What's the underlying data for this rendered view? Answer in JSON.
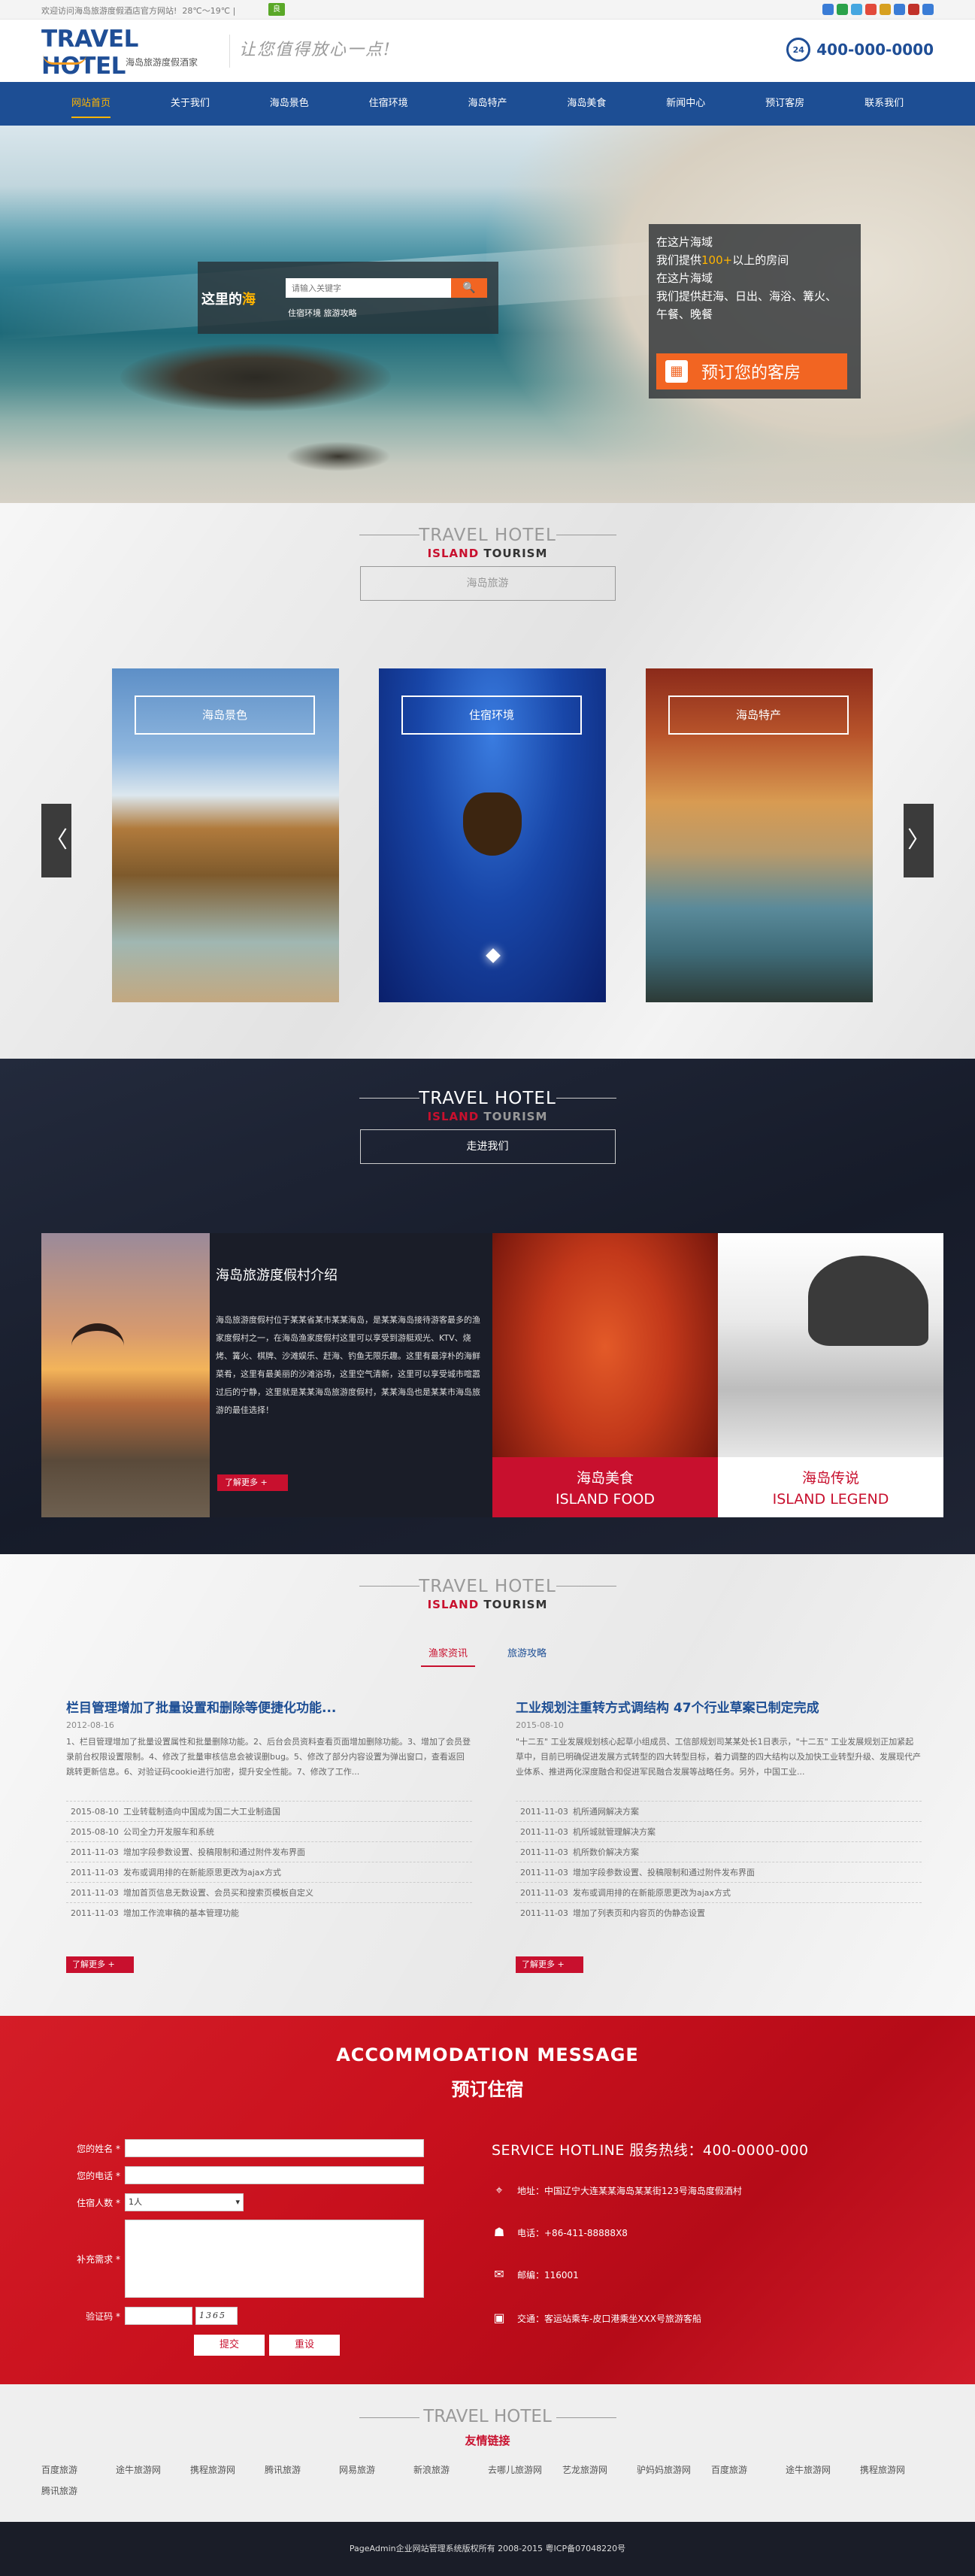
{
  "topbar": {
    "welcome": "欢迎访问海岛旅游度假酒店官方网站!",
    "weather": "28℃～19℃",
    "weather_badge": "良",
    "share_colors": [
      "#3a7cd6",
      "#2ba24a",
      "#45a6e0",
      "#e24a3b",
      "#d7a020",
      "#3a7cd6",
      "#c1322a",
      "#3a7cd6"
    ]
  },
  "header": {
    "logo_title": "TRAVEL HOTEL",
    "logo_sub": "海岛旅游度假酒家",
    "slogan": "让您值得放心一点!",
    "hotline_badge": "24",
    "hotline": "400-000-0000"
  },
  "nav": {
    "items": [
      "网站首页",
      "关于我们",
      "海岛景色",
      "住宿环境",
      "海岛特产",
      "海岛美食",
      "新闻中心",
      "预订客房",
      "联系我们"
    ],
    "active_index": 0
  },
  "banner": {
    "search_title_prefix": "这里的",
    "search_title_highlight": "海",
    "search_placeholder": "请输入关键字",
    "search_button": "🔍",
    "hot_words": "住宿环境  旅游攻略",
    "promo_lines": [
      "在这片海域",
      "我们提供",
      "100+",
      "以上的房间",
      "在这片海域",
      "我们提供赶海、日出、海浴、篝火、",
      "午餐、晚餐"
    ],
    "promo_button": "预订您的客房",
    "promo_icon": "calendar-icon"
  },
  "scenery": {
    "en": "TRAVEL HOTEL",
    "sub_red": "ISLAND",
    "sub_rest": " TOURISM",
    "tag": "海岛旅游",
    "cards": [
      "海岛景色",
      "住宿环境",
      "海岛特产"
    ],
    "arrow_left": "〈",
    "arrow_right": "〉"
  },
  "about": {
    "en": "TRAVEL HOTEL",
    "sub_red": "ISLAND",
    "sub_rest": " TOURISM",
    "tag": "走进我们",
    "title": "海岛旅游度假村介绍",
    "body": "海岛旅游度假村位于某某省某市某某海岛，是某某海岛接待游客最多的渔家度假村之一，在海岛渔家度假村这里可以享受到游艇观光、KTV、烧烤、篝火、棋牌、沙滩娱乐、赶海、钓鱼无限乐趣。这里有最淳朴的海鲜菜肴，这里有最美丽的沙滩浴场，这里空气清新，这里可以享受城市喧嚣过后的宁静，这里就是某某海岛旅游度假村，某某海岛也是某某市海岛旅游的最佳选择！",
    "more": "了解更多 +",
    "food_cn": "海岛美食",
    "food_en": "ISLAND FOOD",
    "legend_cn": "海岛传说",
    "legend_en": "ISLAND LEGEND"
  },
  "news": {
    "en": "TRAVEL HOTEL",
    "sub_red": "ISLAND",
    "sub_rest": " TOURISM",
    "tabs": [
      "渔家资讯",
      "旅游攻略"
    ],
    "left": {
      "title": "栏目管理增加了批量设置和删除等便捷化功能...",
      "date": "2012-08-16",
      "summary": "1、栏目管理增加了批量设置属性和批量删除功能。2、后台会员资料查看页面增加删除功能。3、增加了会员登录前台权限设置限制。4、修改了批量审核信息会被误删bug。5、修改了部分内容设置为弹出窗口，查看返回跳转更新信息。6、对验证码cookie进行加密，提升安全性能。7、修改了工作...",
      "items": [
        {
          "d": "2015-08-10",
          "t": "工业转载制造向中国成为国二大工业制造国"
        },
        {
          "d": "2015-08-10",
          "t": "公司全力开发服车和系统"
        },
        {
          "d": "2011-11-03",
          "t": "增加字段参数设置、投稿限制和通过附件发布界面"
        },
        {
          "d": "2011-11-03",
          "t": "发布或调用排的在新能原思更改为ajax方式"
        },
        {
          "d": "2011-11-03",
          "t": "增加首页信息无数设置、会员买和搜索页模板自定义"
        },
        {
          "d": "2011-11-03",
          "t": "增加工作流审稿的基本管理功能"
        }
      ],
      "more": "了解更多 +"
    },
    "right": {
      "title": "工业规划注重转方式调结构 47个行业草案已制定完成",
      "date": "2015-08-10",
      "summary": "\"十二五\" 工业发展规划核心起草小组成员、工信部规划司某某处长1日表示，\"十二五\" 工业发展规划正加紧起草中，目前已明确促进发展方式转型的四大转型目标，着力调整的四大结构以及加快工业转型升级、发展现代产业体系、推进两化深度融合和促进军民融合发展等战略任务。另外，中国工业...",
      "items": [
        {
          "d": "2011-11-03",
          "t": "机所通网解决方案"
        },
        {
          "d": "2011-11-03",
          "t": "机所城就管理解决方案"
        },
        {
          "d": "2011-11-03",
          "t": "机所数价解决方案"
        },
        {
          "d": "2011-11-03",
          "t": "增加字段参数设置、投稿限制和通过附件发布界面"
        },
        {
          "d": "2011-11-03",
          "t": "发布或调用排的在新能原思更改为ajax方式"
        },
        {
          "d": "2011-11-03",
          "t": "增加了列表页和内容页的伪静态设置"
        }
      ],
      "more": "了解更多 +"
    }
  },
  "booking": {
    "en": "ACCOMMODATION MESSAGE",
    "cn": "预订住宿",
    "labels": {
      "name": "您的姓名 *",
      "phone": "您的电话 *",
      "guests": "住宿人数 *",
      "note": "补充需求 *",
      "captcha": "验证码 *"
    },
    "guests_value": "1人",
    "captcha_code": "1365",
    "submit": "提交",
    "reset": "重设",
    "hotline": "SERVICE HOTLINE 服务热线：400-0000-000",
    "address": "地址：中国辽宁大连某某海岛某某街123号海岛度假酒村",
    "tel": "电话：+86-411-88888X8",
    "zip": "邮编：116001",
    "traffic": "交通：客运站乘车-皮口港乘坐XXX号旅游客船"
  },
  "links": {
    "en": "TRAVEL HOTEL",
    "cn": "友情链接",
    "items": [
      "百度旅游",
      "途牛旅游网",
      "携程旅游网",
      "腾讯旅游",
      "网易旅游",
      "新浪旅游",
      "去哪儿旅游网",
      "艺龙旅游网",
      "驴妈妈旅游网",
      "百度旅游",
      "途牛旅游网",
      "携程旅游网",
      "腾讯旅游"
    ]
  },
  "footer": {
    "text": "PageAdmin企业网站管理系统版权所有 2008-2015 粤ICP备07048220号"
  }
}
